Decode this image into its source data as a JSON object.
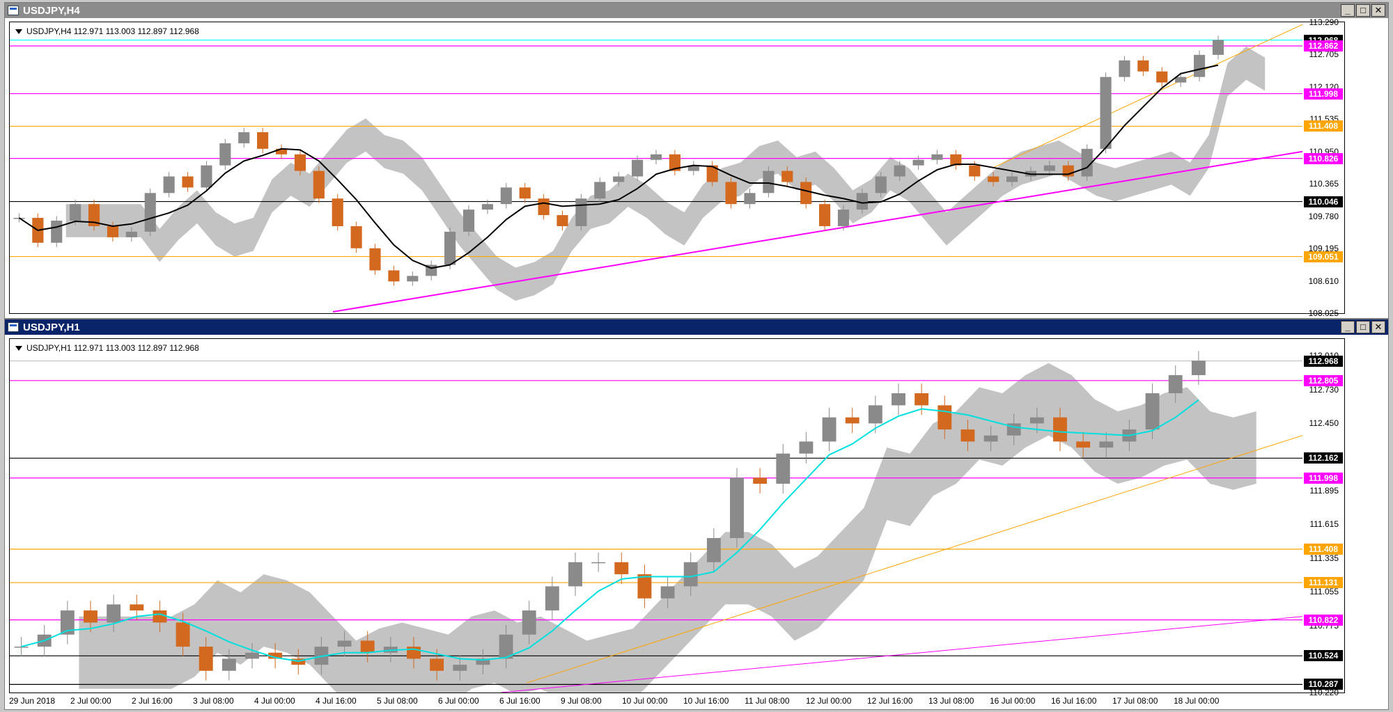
{
  "colors": {
    "magenta": "#ff00ff",
    "orange": "#ffa500",
    "cyan": "#00ffff",
    "cloud_grey": "#b4b4b4",
    "candle_up": "#8a8a8a",
    "candle_down": "#d2691e",
    "black_line": "#000000",
    "title_active": "#0a246a",
    "title_inactive": "#8c8c8c"
  },
  "windows": [
    {
      "title": "USDJPY,H4",
      "info": "USDJPY,H4  112.971 113.003 112.897 112.968",
      "buttons": [
        "_",
        "□",
        "✕"
      ],
      "yticks": [
        "113.290",
        "112.705",
        "112.120",
        "111.535",
        "110.950",
        "110.365",
        "109.780",
        "109.195",
        "108.610",
        "108.025"
      ],
      "ymin": 108.025,
      "ymax": 113.29,
      "levels": [
        {
          "value": "112.968",
          "price": 112.968,
          "color": "#00ffff",
          "label_bg": "#000000",
          "label_fg": "#ffffff"
        },
        {
          "value": "112.862",
          "price": 112.862,
          "color": "#ff00ff",
          "label_bg": "#ff00ff",
          "label_fg": "#ffffff"
        },
        {
          "value": "111.998",
          "price": 111.998,
          "color": "#ff00ff",
          "label_bg": "#ff00ff",
          "label_fg": "#ffffff"
        },
        {
          "value": "111.408",
          "price": 111.408,
          "color": "#ffa500",
          "label_bg": "#ffa500",
          "label_fg": "#ffffff"
        },
        {
          "value": "110.826",
          "price": 110.826,
          "color": "#ff00ff",
          "label_bg": "#ff00ff",
          "label_fg": "#ffffff"
        },
        {
          "value": "110.046",
          "price": 110.046,
          "color": "#000000",
          "label_bg": "#000000",
          "label_fg": "#ffffff"
        },
        {
          "value": "109.051",
          "price": 109.051,
          "color": "#ffa500",
          "label_bg": "#ffa500",
          "label_fg": "#ffffff"
        }
      ],
      "trendlines": [
        {
          "color": "#ff00ff",
          "from": [
            0.25,
            108.05
          ],
          "to": [
            1.0,
            110.95
          ],
          "width": 2
        },
        {
          "color": "#ffa500",
          "from": [
            0.76,
            110.65
          ],
          "to": [
            1.0,
            113.25
          ],
          "width": 1
        }
      ],
      "price_path": [
        109.75,
        109.3,
        109.7,
        110.0,
        109.6,
        109.4,
        109.5,
        110.2,
        110.5,
        110.3,
        110.7,
        111.1,
        111.3,
        111.0,
        110.9,
        110.6,
        110.1,
        109.6,
        109.2,
        108.8,
        108.6,
        108.7,
        108.9,
        109.5,
        109.9,
        110.0,
        110.3,
        110.1,
        109.8,
        109.6,
        110.1,
        110.4,
        110.5,
        110.8,
        110.9,
        110.6,
        110.7,
        110.4,
        110.0,
        110.2,
        110.6,
        110.4,
        110.0,
        109.6,
        109.9,
        110.2,
        110.5,
        110.7,
        110.8,
        110.9,
        110.7,
        110.5,
        110.4,
        110.5,
        110.6,
        110.7,
        110.5,
        111.0,
        112.3,
        112.6,
        112.4,
        112.2,
        112.3,
        112.7,
        112.97
      ]
    },
    {
      "title": "USDJPY,H1",
      "info": "USDJPY,H1  112.971 113.003 112.897 112.968",
      "buttons": [
        "_",
        "□",
        "✕"
      ],
      "yticks": [
        "113.010",
        "112.730",
        "112.450",
        "112.170",
        "111.895",
        "111.615",
        "111.335",
        "111.055",
        "110.775",
        "110.500",
        "110.220"
      ],
      "ymin": 110.22,
      "ymax": 113.15,
      "levels": [
        {
          "value": "112.968",
          "price": 112.968,
          "color": "#c0c0c0",
          "label_bg": "#000000",
          "label_fg": "#ffffff"
        },
        {
          "value": "112.805",
          "price": 112.805,
          "color": "#ff00ff",
          "label_bg": "#ff00ff",
          "label_fg": "#ffffff"
        },
        {
          "value": "112.162",
          "price": 112.162,
          "color": "#000000",
          "label_bg": "#000000",
          "label_fg": "#ffffff"
        },
        {
          "value": "111.998",
          "price": 111.998,
          "color": "#ff00ff",
          "label_bg": "#ff00ff",
          "label_fg": "#ffffff"
        },
        {
          "value": "111.408",
          "price": 111.408,
          "color": "#ffa500",
          "label_bg": "#ffa500",
          "label_fg": "#ffffff"
        },
        {
          "value": "111.131",
          "price": 111.131,
          "color": "#ffa500",
          "label_bg": "#ffa500",
          "label_fg": "#ffffff"
        },
        {
          "value": "110.822",
          "price": 110.822,
          "color": "#ff00ff",
          "label_bg": "#ff00ff",
          "label_fg": "#ffffff"
        },
        {
          "value": "110.524",
          "price": 110.524,
          "color": "#000000",
          "label_bg": "#000000",
          "label_fg": "#ffffff"
        },
        {
          "value": "110.287",
          "price": 110.287,
          "color": "#000000",
          "label_bg": "#000000",
          "label_fg": "#ffffff"
        }
      ],
      "trendlines": [
        {
          "color": "#ff00ff",
          "from": [
            0.38,
            110.22
          ],
          "to": [
            1.0,
            110.85
          ],
          "width": 1
        },
        {
          "color": "#ffa500",
          "from": [
            0.4,
            110.3
          ],
          "to": [
            1.0,
            112.35
          ],
          "width": 1
        }
      ],
      "price_path": [
        110.6,
        110.7,
        110.9,
        110.8,
        110.95,
        110.9,
        110.8,
        110.6,
        110.4,
        110.5,
        110.55,
        110.5,
        110.45,
        110.6,
        110.65,
        110.55,
        110.6,
        110.5,
        110.4,
        110.45,
        110.5,
        110.7,
        110.9,
        111.1,
        111.3,
        111.3,
        111.2,
        111.0,
        111.1,
        111.3,
        111.5,
        112.0,
        111.95,
        112.2,
        112.3,
        112.5,
        112.45,
        112.6,
        112.7,
        112.6,
        112.4,
        112.3,
        112.35,
        112.45,
        112.5,
        112.3,
        112.25,
        112.3,
        112.4,
        112.7,
        112.85,
        112.97
      ]
    }
  ],
  "xaxis_labels": [
    "29 Jun 2018",
    "2 Jul 00:00",
    "2 Jul 16:00",
    "3 Jul 08:00",
    "4 Jul 00:00",
    "4 Jul 16:00",
    "5 Jul 08:00",
    "6 Jul 00:00",
    "6 Jul 16:00",
    "9 Jul 08:00",
    "10 Jul 00:00",
    "10 Jul 16:00",
    "11 Jul 08:00",
    "12 Jul 00:00",
    "12 Jul 16:00",
    "13 Jul 08:00",
    "16 Jul 00:00",
    "16 Jul 16:00",
    "17 Jul 08:00",
    "18 Jul 00:00"
  ]
}
